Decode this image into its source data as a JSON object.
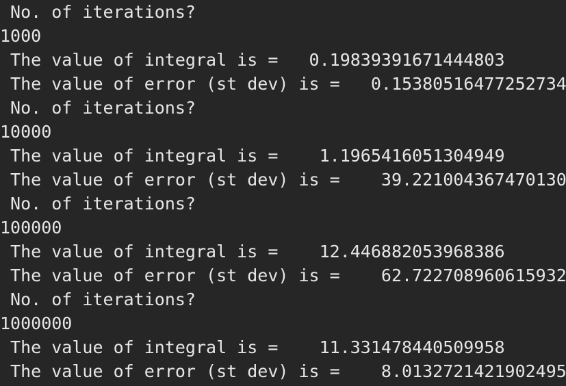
{
  "terminal": {
    "lines": [
      " No. of iterations?",
      "1000",
      " The value of integral is =   0.19839391671444803",
      " The value of error (st dev) is =   0.15380516477252734",
      " No. of iterations?",
      "10000",
      " The value of integral is =    1.1965416051304949",
      " The value of error (st dev) is =    39.221004367470130",
      " No. of iterations?",
      "100000",
      " The value of integral is =    12.446882053968386",
      " The value of error (st dev) is =    62.722708960615932",
      " No. of iterations?",
      "1000000",
      " The value of integral is =    11.331478440509958",
      " The value of error (st dev) is =    8.0132721421902495"
    ]
  }
}
